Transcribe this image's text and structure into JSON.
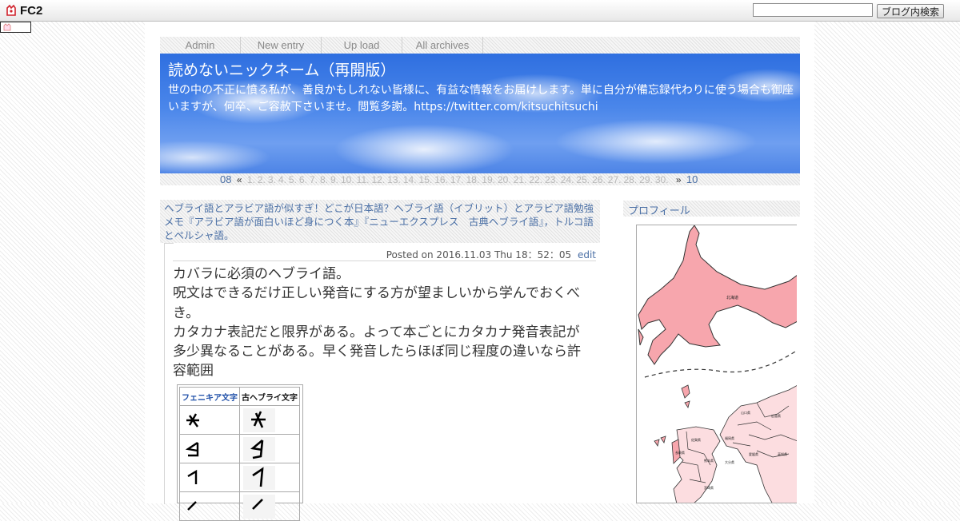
{
  "fc2": {
    "logo": "FC2",
    "search_button": "ブログ内検索",
    "search_value": ""
  },
  "menu": [
    {
      "label": "Admin"
    },
    {
      "label": "New entry"
    },
    {
      "label": "Up load"
    },
    {
      "label": "All archives"
    }
  ],
  "blog": {
    "title": "読めないニックネーム（再開版）",
    "description": "世の中の不正に憤る私が、善良かもしれない皆様に、有益な情報をお届けします。単に自分が備忘録代わりに使う場合も御座いますが、何卒、ご容赦下さいませ。閲覧多謝。https://twitter.com/kitsuchitsuchi"
  },
  "calendar": {
    "prev_month": "08",
    "prev_arrow": "«",
    "days": [
      "1.",
      "2.",
      "3.",
      "4.",
      "5.",
      "6.",
      "7.",
      "8.",
      "9.",
      "10.",
      "11.",
      "12.",
      "13.",
      "14.",
      "15.",
      "16.",
      "17.",
      "18.",
      "19.",
      "20.",
      "21.",
      "22.",
      "23.",
      "24.",
      "25.",
      "26.",
      "27.",
      "28.",
      "29.",
      "30."
    ],
    "next_arrow": "»",
    "next_month": "10"
  },
  "entry": {
    "title": "ヘブライ語とアラビア語が似すぎ！どこが日本語？ヘブライ語（イブリット）とアラビア語勉強メモ『アラビア語が面白いほど身につく本』『ニューエクスプレス　古典ヘブライ語』，トルコ語とペルシャ語。",
    "posted": "Posted on 2016.11.03 Thu 18：52：05",
    "edit": "edit",
    "body": [
      "カバラに必須のヘブライ語。",
      "呪文はできるだけ正しい発音にする方が望ましいから学んでおくべき。",
      "カタカナ表記だと限界がある。よって本ごとにカタカナ発音表記が多少異なることがある。早く発音したらほぼ同じ程度の違いなら許容範囲"
    ],
    "table": {
      "col1": "フェニキア文字",
      "col2": "古ヘブライ文字"
    }
  },
  "sidebar": {
    "profile_heading": "プロフィール"
  }
}
